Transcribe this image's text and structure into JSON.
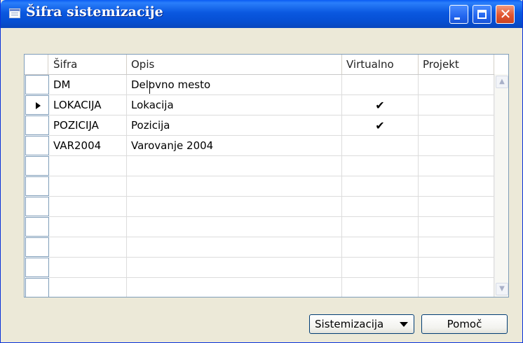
{
  "window": {
    "title": "Šifra sistemizacije"
  },
  "titlebar": {
    "minimize_icon": "minimize-icon",
    "maximize_icon": "maximize-icon",
    "close_icon": "close-icon"
  },
  "table": {
    "columns": [
      "Šifra",
      "Opis",
      "Virtualno",
      "Projekt"
    ],
    "rows": [
      {
        "sifra": "DM",
        "opis": "Delovno mesto",
        "virtualno": "",
        "projekt": ""
      },
      {
        "sifra": "LOKACIJA",
        "opis": "Lokacija",
        "virtualno": "✔",
        "projekt": ""
      },
      {
        "sifra": "POZICIJA",
        "opis": "Pozicija",
        "virtualno": "✔",
        "projekt": ""
      },
      {
        "sifra": "VAR2004",
        "opis": "Varovanje 2004",
        "virtualno": "",
        "projekt": ""
      }
    ],
    "current_row_index": 1,
    "empty_rows": 7
  },
  "buttons": {
    "sistemizacija": "Sistemizacija",
    "pomoc": "Pomoč"
  },
  "colors": {
    "titlebar": "#0a58e0",
    "close": "#e2552f",
    "window_bg": "#ece9d8",
    "grid_border": "#7f9db9"
  }
}
